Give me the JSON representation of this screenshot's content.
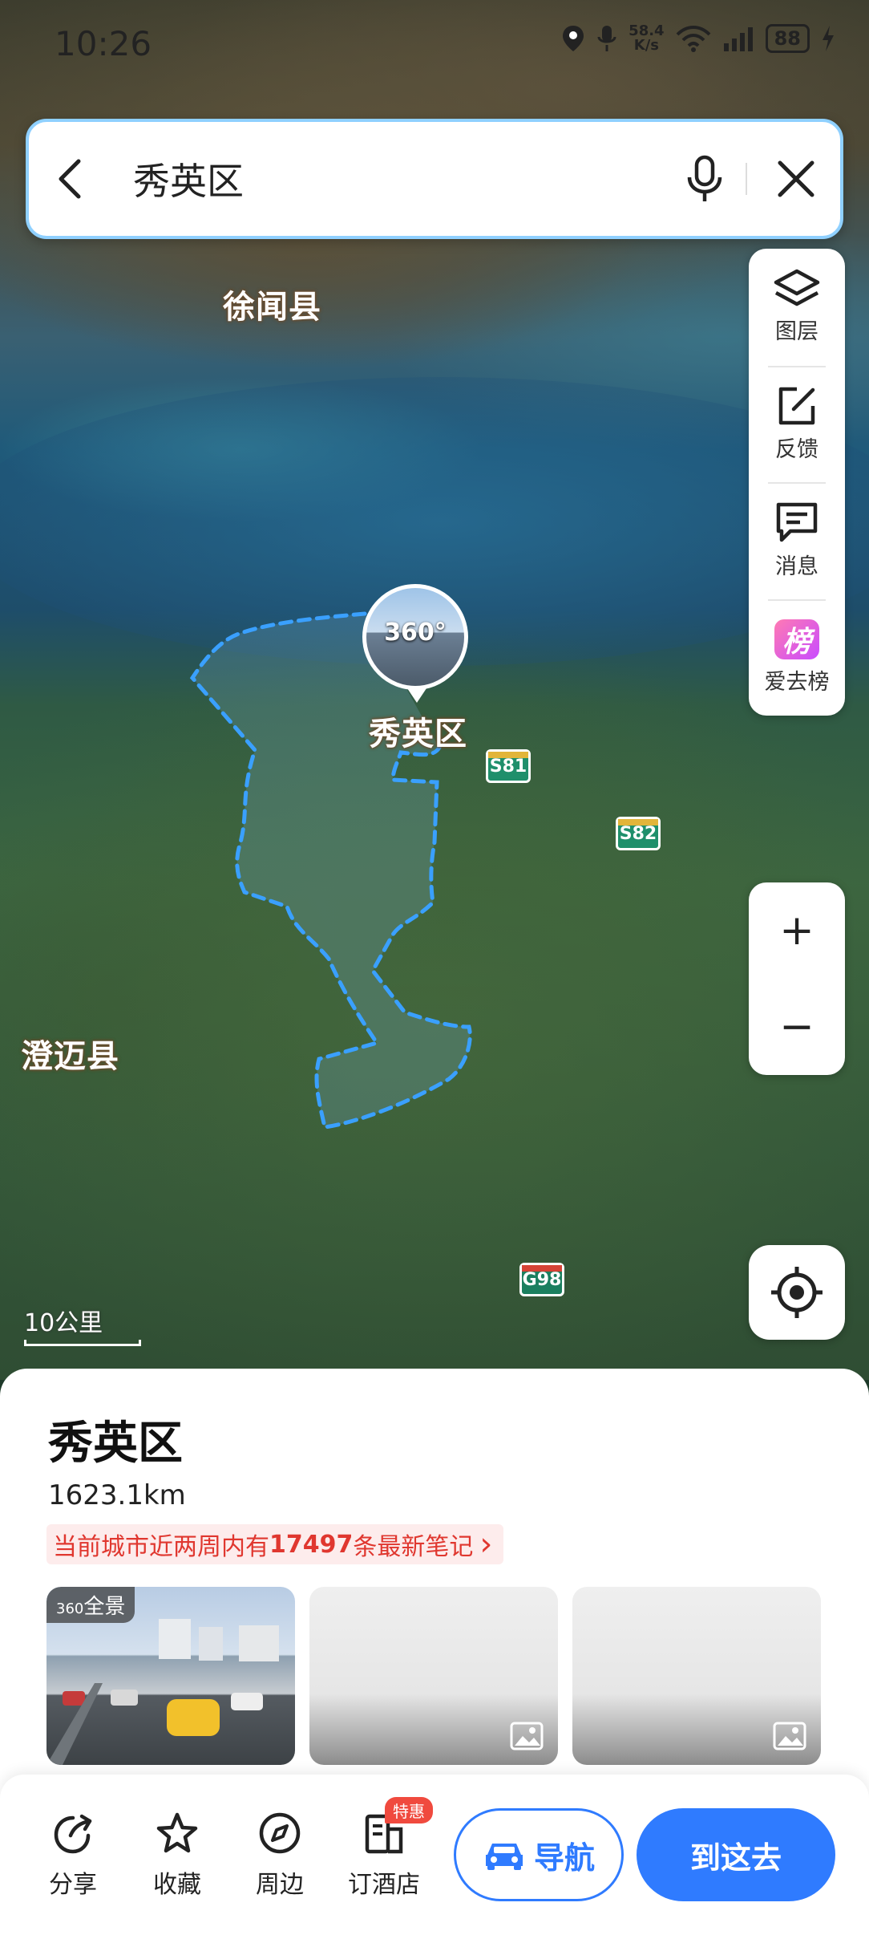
{
  "status_bar": {
    "time": "10:26",
    "net_speed_value": "58.4",
    "net_speed_unit": "K/s",
    "battery": "88"
  },
  "search": {
    "query": "秀英区"
  },
  "map": {
    "labels": {
      "xuwen": "徐闻县",
      "chengmai": "澄迈县",
      "district": "秀英区"
    },
    "pano_marker_text": "360°",
    "roads": [
      "S81",
      "S82",
      "G98"
    ],
    "scale": "10公里"
  },
  "tools": {
    "layers": "图层",
    "feedback": "反馈",
    "messages": "消息",
    "ranking": "爱去榜",
    "ranking_glyph": "榜"
  },
  "zoom": {
    "in": "+",
    "out": "−"
  },
  "sheet": {
    "title": "秀英区",
    "distance": "1623.1km",
    "notes_prefix": "当前城市近两周内有",
    "notes_count": "17497",
    "notes_suffix": "条最新笔记",
    "notes_arrow": "›",
    "pano_tag": "全景",
    "pano_tag_prefix": "360"
  },
  "actions": {
    "share": "分享",
    "favorite": "收藏",
    "nearby": "周边",
    "hotel": "订酒店",
    "hotel_badge": "特惠",
    "navigate": "导航",
    "go_here": "到这去"
  },
  "colors": {
    "accent": "#2f7bff",
    "district_outline": "#3aa0ff",
    "notes_red": "#e0372f"
  }
}
